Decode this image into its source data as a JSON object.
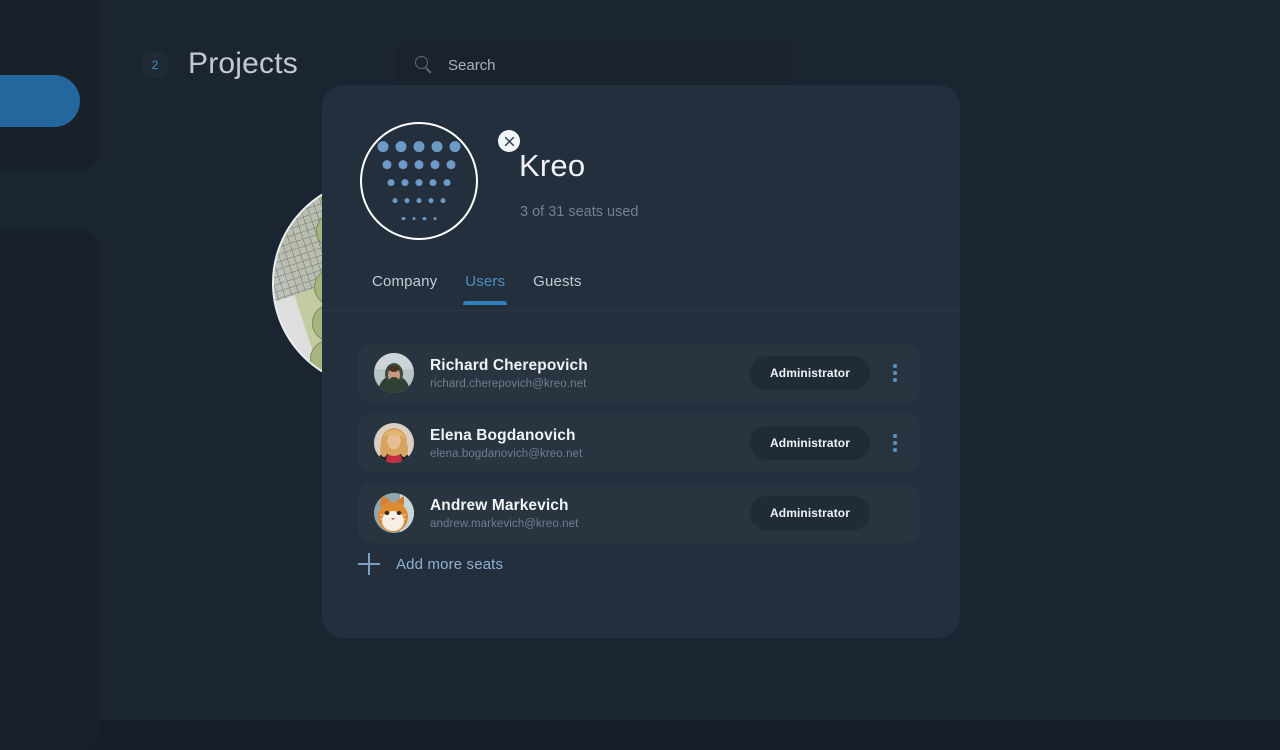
{
  "background": {
    "page_title": "Projects",
    "count_badge": "2",
    "search": {
      "placeholder": "Search",
      "value": "",
      "icon": "search-icon"
    },
    "colors": {
      "page_bg": "#1b2531",
      "panel": "#182029",
      "accent_pill": "#24679e",
      "badge_text": "#3f8ac4"
    }
  },
  "modal": {
    "org_name": "Kreo",
    "seats_used": "3 of 31 seats used",
    "close_icon": "close-icon",
    "logo_icon": "kreo-dot-grid-logo",
    "colors": {
      "surface": "#242f3d",
      "row": "#28343f",
      "accent": "#2f7fbd",
      "tab_active_text": "#4f8fc4"
    },
    "tabs": [
      {
        "label": "Company",
        "active": false
      },
      {
        "label": "Users",
        "active": true
      },
      {
        "label": "Guests",
        "active": false
      }
    ],
    "users": [
      {
        "name": "Richard Cherepovich",
        "email": "richard.cherepovich@kreo.net",
        "role": "Administrator",
        "avatar": "person-in-hooded-coat",
        "has_more_menu": true
      },
      {
        "name": "Elena Bogdanovich",
        "email": "elena.bogdanovich@kreo.net",
        "role": "Administrator",
        "avatar": "blonde-woman-portrait",
        "has_more_menu": true
      },
      {
        "name": "Andrew Markevich",
        "email": "andrew.markevich@kreo.net",
        "role": "Administrator",
        "avatar": "orange-cat",
        "has_more_menu": false
      }
    ],
    "add_seats": {
      "label": "Add more seats",
      "icon": "plus-icon"
    }
  }
}
